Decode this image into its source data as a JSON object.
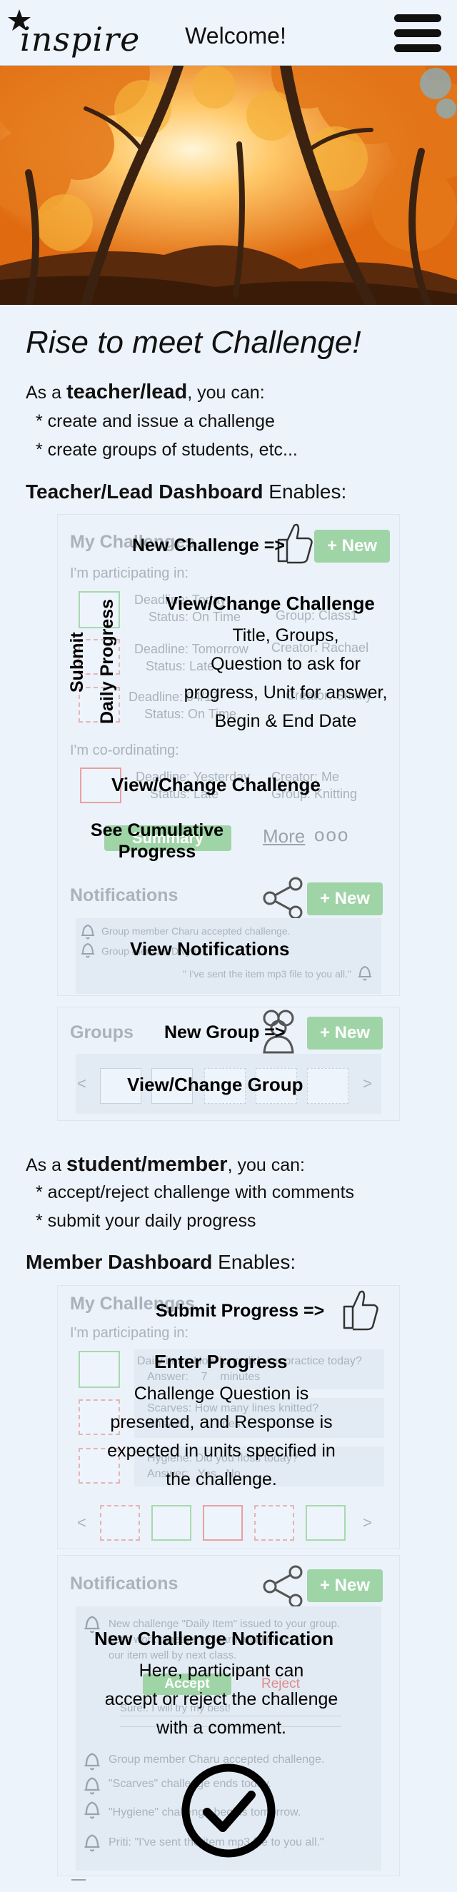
{
  "header": {
    "logo_text": "inspire",
    "title": "Welcome!"
  },
  "intro": {
    "tagline": "Rise to meet Challenge!",
    "teacher_prefix": "As a ",
    "teacher_role": "teacher/lead",
    "teacher_suffix": ", you can:",
    "teacher_bullets": [
      "* create and issue a challenge",
      "* create groups of students, etc..."
    ],
    "teacher_heading_bold": "Teacher/Lead Dashboard",
    "teacher_heading_rest": " Enables:",
    "student_prefix": "As a ",
    "student_role": "student/member",
    "student_suffix": ", you can:",
    "student_bullets": [
      "* accept/reject challenge with comments",
      "* submit your daily progress"
    ],
    "member_heading_bold": "Member Dashboard",
    "member_heading_rest": " Enables:"
  },
  "teacher_mock": {
    "my_challenges": "My Challenges",
    "participating_in": "I'm participating in:",
    "new_label": "+ New",
    "items": [
      {
        "deadline": "Deadline: Today",
        "creator": "Creator: Me",
        "status": "Status: On Time",
        "group": "Group: Class1"
      },
      {
        "deadline": "Deadline: Tomorrow",
        "creator": "Creator: Rachael",
        "status": "Status: Late",
        "group": "Group: Class3"
      },
      {
        "deadline": "Deadline: 04/17",
        "creator": "Creator: Smmy",
        "status": "Status: On Time",
        "group": "Group: Class5"
      }
    ],
    "coordinating": "I'm co-ordinating:",
    "coord_item": {
      "deadline": "Deadline: Yesterday",
      "creator": "Creator: Me",
      "status": "Status: Late",
      "group": "Group: Knitting"
    },
    "summary_btn": "Summary",
    "more_label": "More",
    "more_dots": "ooo",
    "notifications": "Notifications",
    "notif_lines": [
      "Group member Charu accepted challenge.",
      "Group member Divya ...",
      "\" I've sent the item mp3 file to you all.\""
    ],
    "groups": "Groups",
    "prev": "<",
    "next": ">"
  },
  "teacher_annotations": {
    "new_challenge": "New Challenge =>",
    "view_change_title": "View/Change Challenge",
    "view_change_desc": [
      "Title, Groups,",
      "Question to ask for",
      "progress, Unit for answer,",
      "Begin & End Date"
    ],
    "submit_progress_vertical": [
      "Submit",
      "Daily Progress"
    ],
    "view_change_2": "View/Change Challenge",
    "see_cumulative": [
      "See Cumulative",
      "Progress"
    ],
    "view_notifications": "View Notifications",
    "new_group": "New Group =>",
    "view_change_group": "View/Change Group"
  },
  "member_mock": {
    "my_challenges": "My Challenges",
    "participating_in": "I'm participating in:",
    "q1": "Daily item: How long did you practice today?",
    "a1": "Answer:    7    minutes",
    "q2": "Scarves: How many lines knitted?",
    "a2": "Answer:         lines",
    "q3": "Hygiene: Did you floss today?",
    "a3": "Answer:   Yes   No",
    "notifications": "Notifications",
    "new_label": "+ New",
    "notif1": [
      "New challenge \"Daily Item\" issued to your group.",
      "Let's work together to learn and know",
      "our item well by next class."
    ],
    "accept": "Accept",
    "reject": "Reject",
    "comment_value": "Sure.. I will try my best!",
    "notif_lines": [
      "Group member Charu accepted challenge.",
      "\"Scarves\" challenge ends today.",
      "\"Hygiene\" challenge begins tomorrow.",
      "Priti: \"I've sent the item mp3 file to you all.\""
    ],
    "prev": "<",
    "next": ">"
  },
  "member_annotations": {
    "submit_progress": "Submit Progress =>",
    "enter_progress_title": "Enter Progress",
    "enter_progress_desc": [
      "Challenge Question is",
      "presented, and Response is",
      "expected in units specified in",
      "the challenge."
    ],
    "new_challenge_notif_title": "New Challenge Notification",
    "new_challenge_notif_desc": [
      "Here, participant can",
      "accept or reject the challenge",
      "with a comment."
    ]
  },
  "colors": {
    "accent_green": "#9fd4a7",
    "reject_red": "#e08a8a",
    "page_bg": "#edf3fa"
  },
  "icons": [
    "star-icon",
    "hamburger-menu-icon",
    "thumbs-up-icon",
    "share-icon",
    "bell-icon",
    "group-icon",
    "checkmark-circle-icon"
  ]
}
